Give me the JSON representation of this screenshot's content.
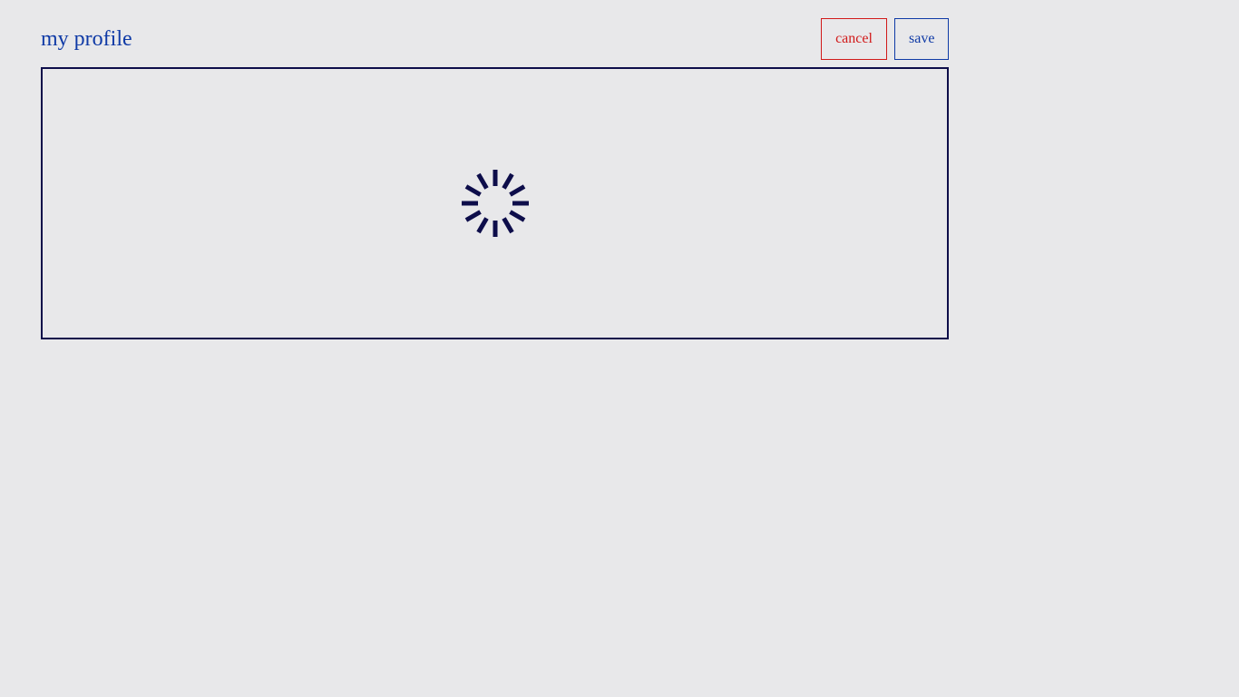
{
  "header": {
    "title": "my profile"
  },
  "actions": {
    "cancel_label": "cancel",
    "save_label": "save"
  },
  "content": {
    "state": "loading",
    "spinner_icon": "loading-spinner-icon"
  },
  "colors": {
    "background": "#e8e8ea",
    "title": "#0f3aa6",
    "cancel": "#d11a1a",
    "save": "#0f3aa6",
    "panel_border": "#0d0d4a",
    "spinner": "#0d0d4a"
  }
}
